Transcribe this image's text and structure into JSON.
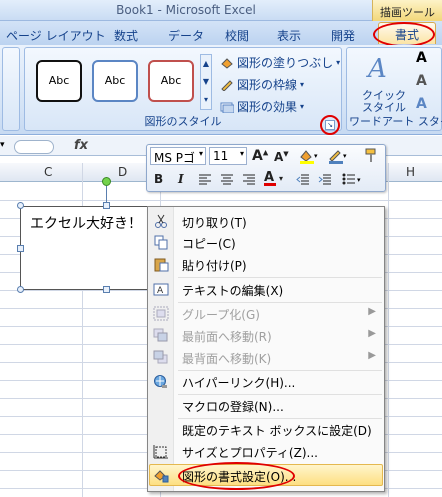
{
  "window": {
    "title": "Book1 - Microsoft Excel",
    "contextual_tab_group": "描画ツール"
  },
  "tabs": [
    "ページ レイアウト",
    "数式",
    "データ",
    "校閲",
    "表示",
    "開発",
    "書式"
  ],
  "ribbon": {
    "shape_style_samples": [
      "Abc",
      "Abc",
      "Abc"
    ],
    "shape_fill": "図形の塗りつぶし",
    "shape_outline": "図形の枠線",
    "shape_effects": "図形の効果",
    "shape_styles_group": "図形のスタイル",
    "quick_style": "クイック\nスタイル",
    "wordart_group": "ワードアート スタイル"
  },
  "formula_bar": {
    "fx": "fx"
  },
  "columns": [
    "C",
    "D",
    "H"
  ],
  "mini_toolbar": {
    "font": "MS Pゴ",
    "size": "11",
    "bold": "B",
    "italic": "I"
  },
  "shape_text": "エクセル大好き！",
  "context_menu": {
    "items": [
      {
        "label": "切り取り(T)",
        "icon": "cut-icon",
        "disabled": false
      },
      {
        "label": "コピー(C)",
        "icon": "copy-icon",
        "disabled": false
      },
      {
        "label": "貼り付け(P)",
        "icon": "paste-icon",
        "disabled": false
      },
      {
        "label": "テキストの編集(X)",
        "icon": "edit-text-icon",
        "disabled": false
      },
      {
        "label": "グループ化(G)",
        "icon": "group-icon",
        "disabled": true
      },
      {
        "label": "最前面へ移動(R)",
        "icon": "bring-front-icon",
        "disabled": true
      },
      {
        "label": "最背面へ移動(K)",
        "icon": "send-back-icon",
        "disabled": true
      },
      {
        "label": "ハイパーリンク(H)...",
        "icon": "hyperlink-icon",
        "disabled": false
      },
      {
        "label": "マクロの登録(N)...",
        "icon": "",
        "disabled": false
      },
      {
        "label": "既定のテキスト ボックスに設定(D)",
        "icon": "",
        "disabled": false
      },
      {
        "label": "サイズとプロパティ(Z)...",
        "icon": "size-icon",
        "disabled": false
      },
      {
        "label": "図形の書式設定(O)...",
        "icon": "format-shape-icon",
        "disabled": false
      }
    ]
  },
  "colors": {
    "highlight_ring": "#e00000",
    "tab_text": "#15428b"
  }
}
